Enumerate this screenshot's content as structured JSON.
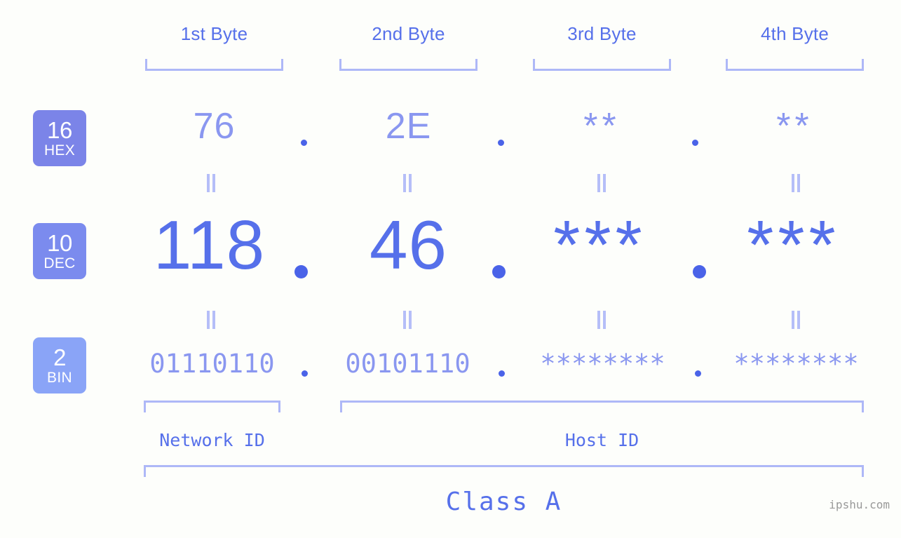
{
  "background_color": "#fdfefb",
  "palette": {
    "accent_dark": "#5670ea",
    "accent_mid": "#8a97f0",
    "accent_light": "#aeb8f7",
    "dot_color": "#4a63e8",
    "badge_hex": "#7b84e8",
    "badge_dec": "#7b8bee",
    "badge_bin": "#8aa4f7",
    "watermark": "#999999"
  },
  "byte_headers": [
    {
      "label": "1st Byte"
    },
    {
      "label": "2nd Byte"
    },
    {
      "label": "3rd Byte"
    },
    {
      "label": "4th Byte"
    }
  ],
  "rows": [
    {
      "badge": {
        "number": "16",
        "name": "HEX"
      },
      "values": [
        "76",
        "2E",
        "**",
        "**"
      ],
      "separators": [
        ".",
        ".",
        "."
      ]
    },
    {
      "badge": {
        "number": "10",
        "name": "DEC"
      },
      "values": [
        "118",
        "46",
        "***",
        "***"
      ],
      "separators": [
        ".",
        ".",
        "."
      ]
    },
    {
      "badge": {
        "number": "2",
        "name": "BIN"
      },
      "values": [
        "01110110",
        "00101110",
        "********",
        "********"
      ],
      "separators": [
        ".",
        ".",
        "."
      ]
    }
  ],
  "equals_symbol": "=",
  "regions": [
    {
      "label": "Network ID"
    },
    {
      "label": "Host ID"
    }
  ],
  "class": {
    "label": "Class A"
  },
  "watermark": {
    "text": "ipshu.com"
  }
}
